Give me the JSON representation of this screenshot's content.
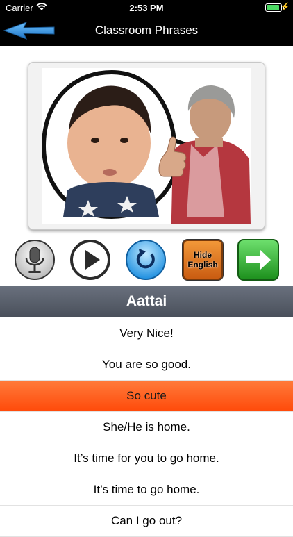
{
  "status_bar": {
    "carrier": "Carrier",
    "time": "2:53 PM",
    "battery_level": 1.0
  },
  "nav": {
    "title": "Classroom Phrases",
    "back_icon": "blue-arrow-left-icon"
  },
  "controls": {
    "mic_icon": "microphone-icon",
    "play_icon": "play-icon",
    "replay_icon": "replay-icon",
    "hide_label_1": "Hide",
    "hide_label_2": "English",
    "next_icon": "arrow-right-icon"
  },
  "section": {
    "title": "Aattai"
  },
  "phrases": [
    {
      "text": "Very Nice!",
      "selected": false
    },
    {
      "text": "You are so good.",
      "selected": false
    },
    {
      "text": "So cute",
      "selected": true
    },
    {
      "text": "She/He is home.",
      "selected": false
    },
    {
      "text": "It’s time for you to go home.",
      "selected": false
    },
    {
      "text": "It’s time to go home.",
      "selected": false
    },
    {
      "text": "Can I go out?",
      "selected": false
    }
  ],
  "colors": {
    "selected_row": "#ff5a1e",
    "header": "#545a66",
    "back_arrow": "#2f8fd6",
    "next_button": "#2faa2f"
  }
}
